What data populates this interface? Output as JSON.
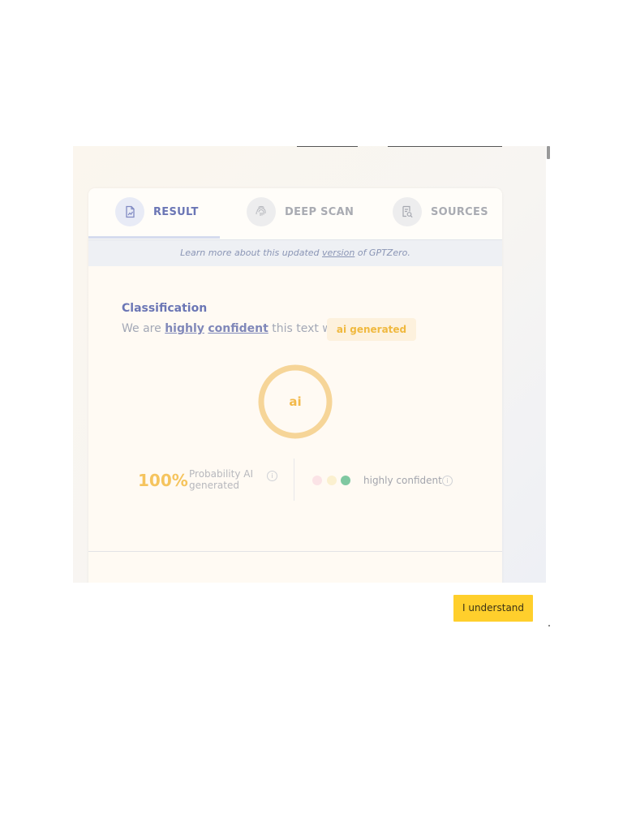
{
  "tabs": [
    {
      "label": "RESULT",
      "icon": "document-chart-icon",
      "active": true
    },
    {
      "label": "DEEP SCAN",
      "icon": "fingerprint-icon",
      "active": false
    },
    {
      "label": "SOURCES",
      "icon": "document-search-icon",
      "active": false
    }
  ],
  "notice": {
    "prefix": "Learn more about this updated ",
    "link": "version",
    "suffix": " of GPTZero."
  },
  "classification": {
    "title": "Classification",
    "sentence_start": "We are ",
    "word_highly": "highly",
    "word_confident": "confident",
    "sentence_end": " this text was",
    "badge": "ai generated",
    "ring_label": "ai"
  },
  "stats": {
    "percent": "100%",
    "probability_label": "Probability AI generated",
    "confidence_label": "highly confident",
    "info_glyph": "i"
  },
  "button": {
    "label": "I understand"
  },
  "colors": {
    "accent_blue": "#6b76b5",
    "ai_yellow": "#f3b94a",
    "button_yellow": "#ffcf2c",
    "dot_pink": "#fbe3e6",
    "dot_yellow": "#fbf0cf",
    "dot_green": "#7fc8a1"
  }
}
